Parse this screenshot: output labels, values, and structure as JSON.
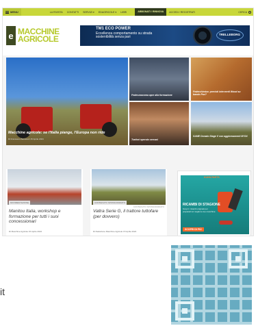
{
  "topbar": {
    "menu_label": "MENU",
    "nav": [
      "LA RIVISTA",
      "CONTATTI",
      "SERVIZI ▾",
      "EDAGRICOLE ▾",
      "LIBRI"
    ],
    "subscribe_label": "ABBONATI / RINNOVA",
    "account_label": "ACCEDI / REGISTRATI",
    "search_label": "CERCA"
  },
  "header": {
    "logo_letter": "e",
    "logo_line1": "MACCHINE",
    "logo_line2": "AGRICOLE",
    "ad": {
      "title": "TM1 ECO POWER",
      "line1": "Eccellenza comportamento su strada",
      "line2": "sostenibilità senza pari",
      "brand": "TRELLEBORG"
    }
  },
  "hero": {
    "title": "Macchine agricole: se l'Italia piange, l'Europa non ride",
    "meta": "Di Francesco Bartolucci 15 Aprile 2024"
  },
  "tiles": [
    {
      "caption": "Federunacoma apre alla formazione",
      "meta": ""
    },
    {
      "caption": "Federchimica: previsti interventi Wood su bando Pac?",
      "meta": ""
    },
    {
      "caption": "Trattori operaio cercasi",
      "meta": ""
    },
    {
      "caption": "SAME Dorado Stage V con aggiornamenti MY24",
      "meta": ""
    }
  ],
  "cards": [
    {
      "tag": "MOVIMENTAZIONE",
      "title": "Manitou Italia, workshop e formazione per tutti i suoi concessionari",
      "meta": "Di Macchine Agricole 15 Aprile 2024"
    },
    {
      "tag": "CONTENUTO SPONSORIZZATO",
      "tag2": "CONTENUTO SPONSORIZZATO",
      "title": "Valtra Serie G, il trattore tuttofare (per dovvero)",
      "meta": "Di Redazione Macchine Agricole 15 Aprile 2024"
    }
  ],
  "side_ad": {
    "brand": "KUHN PARTS",
    "title": "RICAMBI DI STAGIONE",
    "text": "Scopri i ricambi originali per prepararti al meglio le tue macchine",
    "cta": "SCOPRI DI PIÙ"
  },
  "below": {
    "text": "it"
  }
}
